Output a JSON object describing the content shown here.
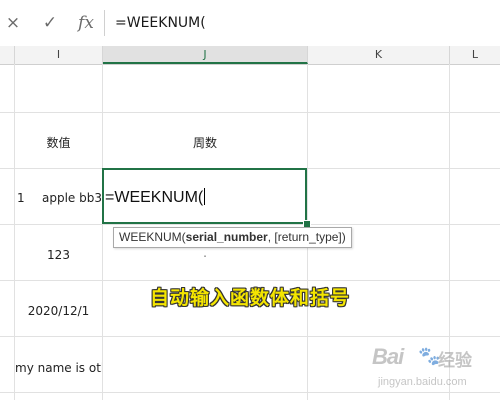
{
  "formula_bar": {
    "cancel_icon": "×",
    "enter_icon": "✓",
    "fx_label": "fx",
    "value": "=WEEKNUM("
  },
  "columns": [
    {
      "name": "I",
      "active": false
    },
    {
      "name": "J",
      "active": true
    },
    {
      "name": "K",
      "active": false
    },
    {
      "name": "L",
      "active": false
    }
  ],
  "cells": {
    "header_value": "数值",
    "header_week": "周数",
    "row_number": "1",
    "r1_value": "apple bb3",
    "r2_value": "123",
    "r2_week": ".",
    "r3_value": "2020/12/1",
    "r4_value": "my name is otk"
  },
  "active_cell": {
    "content": "=WEEKNUM("
  },
  "tooltip": {
    "func": "WEEKNUM(",
    "arg1": "serial_number",
    "rest": ", [return_type])"
  },
  "annotation": "自动输入函数体和括号",
  "watermark": {
    "logo": "Bai",
    "paw": "🐾",
    "text": "经验",
    "url": "jingyan.baidu.com"
  },
  "colors": {
    "excel_green": "#217346",
    "annotation_yellow": "#f4e500"
  }
}
